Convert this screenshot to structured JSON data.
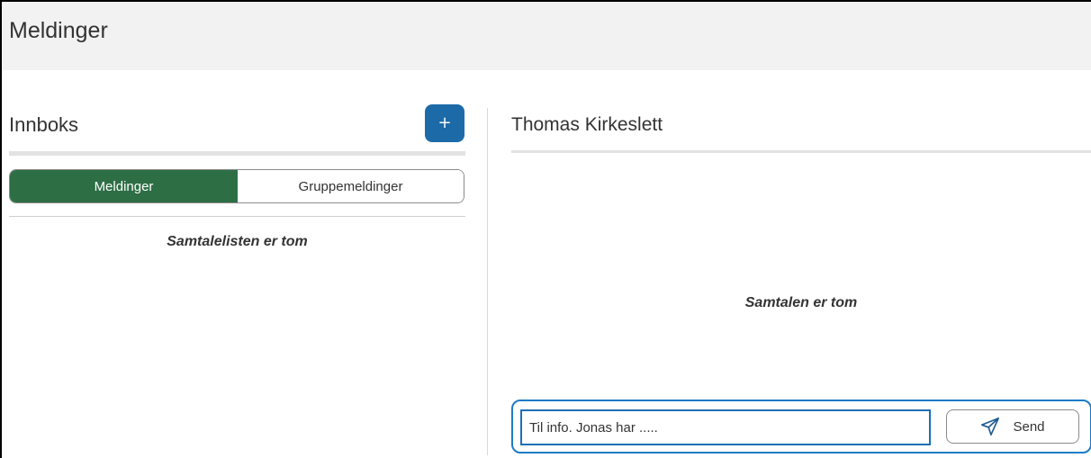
{
  "header": {
    "title": "Meldinger"
  },
  "inbox": {
    "title": "Innboks",
    "new_button_label": "+",
    "tabs": [
      {
        "label": "Meldinger",
        "active": true
      },
      {
        "label": "Gruppemeldinger",
        "active": false
      }
    ],
    "empty_text": "Samtalelisten er tom"
  },
  "conversation": {
    "title": "Thomas Kirkeslett",
    "empty_text": "Samtalen er tom",
    "compose": {
      "value": "Til info. Jonas har .....",
      "send_label": "Send",
      "send_icon": "paper-plane-icon"
    }
  },
  "colors": {
    "primary_blue": "#1d6aa8",
    "active_tab_green": "#2d6e45",
    "focus_blue": "#1d7bc7"
  }
}
